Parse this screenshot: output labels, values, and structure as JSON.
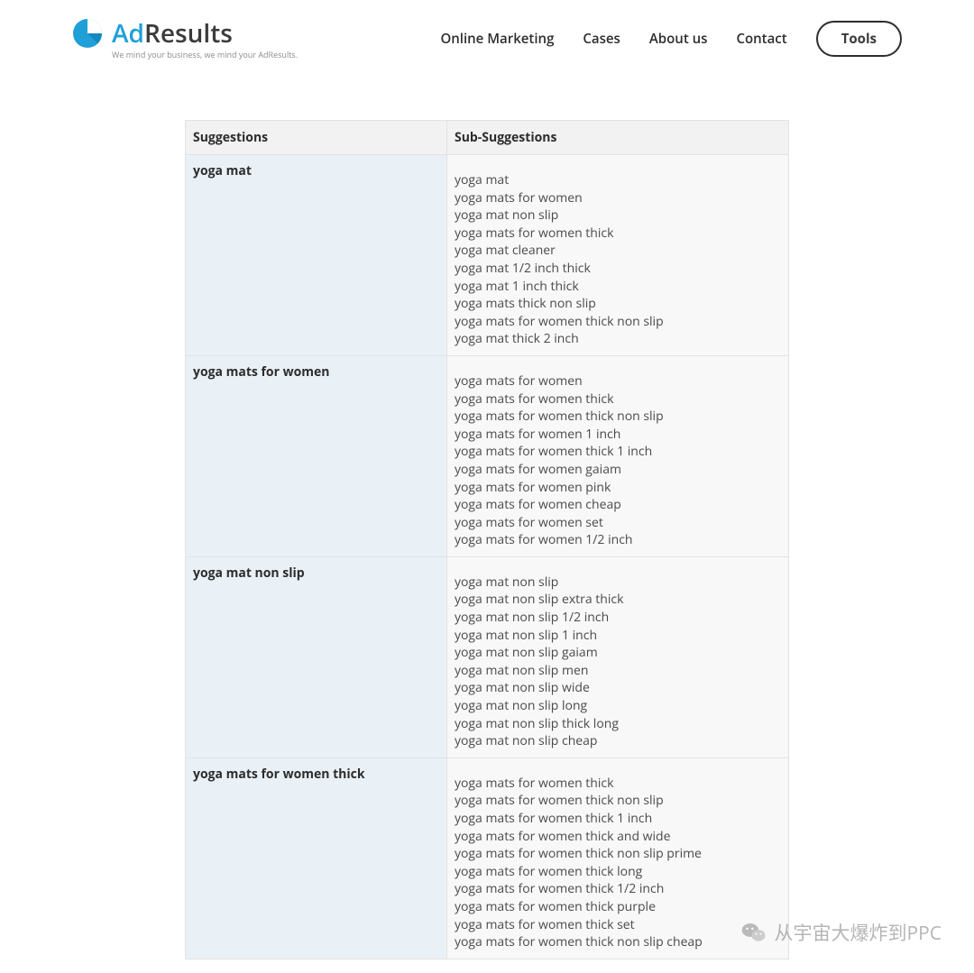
{
  "brand": {
    "name_prefix": "Ad",
    "name_suffix": "Results",
    "tagline": "We mind your business, we mind your AdResults.",
    "accent_color": "#20a0d8"
  },
  "nav": {
    "items": [
      {
        "label": "Online Marketing"
      },
      {
        "label": "Cases"
      },
      {
        "label": "About us"
      },
      {
        "label": "Contact"
      }
    ],
    "tools_label": "Tools"
  },
  "table": {
    "headers": {
      "suggestions": "Suggestions",
      "sub": "Sub-Suggestions"
    },
    "rows": [
      {
        "suggestion": "yoga mat",
        "subs": [
          "yoga mat",
          "yoga mats for women",
          "yoga mat non slip",
          "yoga mats for women thick",
          "yoga mat cleaner",
          "yoga mat 1/2 inch thick",
          "yoga mat 1 inch thick",
          "yoga mats thick non slip",
          "yoga mats for women thick non slip",
          "yoga mat thick 2 inch"
        ]
      },
      {
        "suggestion": "yoga mats for women",
        "subs": [
          "yoga mats for women",
          "yoga mats for women thick",
          "yoga mats for women thick non slip",
          "yoga mats for women 1 inch",
          "yoga mats for women thick 1 inch",
          "yoga mats for women gaiam",
          "yoga mats for women pink",
          "yoga mats for women cheap",
          "yoga mats for women set",
          "yoga mats for women 1/2 inch"
        ]
      },
      {
        "suggestion": "yoga mat non slip",
        "subs": [
          "yoga mat non slip",
          "yoga mat non slip extra thick",
          "yoga mat non slip 1/2 inch",
          "yoga mat non slip 1 inch",
          "yoga mat non slip gaiam",
          "yoga mat non slip men",
          "yoga mat non slip wide",
          "yoga mat non slip long",
          "yoga mat non slip thick long",
          "yoga mat non slip cheap"
        ]
      },
      {
        "suggestion": "yoga mats for women thick",
        "subs": [
          "yoga mats for women thick",
          "yoga mats for women thick non slip",
          "yoga mats for women thick 1 inch",
          "yoga mats for women thick and wide",
          "yoga mats for women thick non slip prime",
          "yoga mats for women thick long",
          "yoga mats for women thick 1/2 inch",
          "yoga mats for women thick purple",
          "yoga mats for women thick set",
          "yoga mats for women thick non slip cheap"
        ]
      }
    ]
  },
  "watermark": {
    "text": "从宇宙大爆炸到PPC",
    "icon": "wechat-icon"
  }
}
